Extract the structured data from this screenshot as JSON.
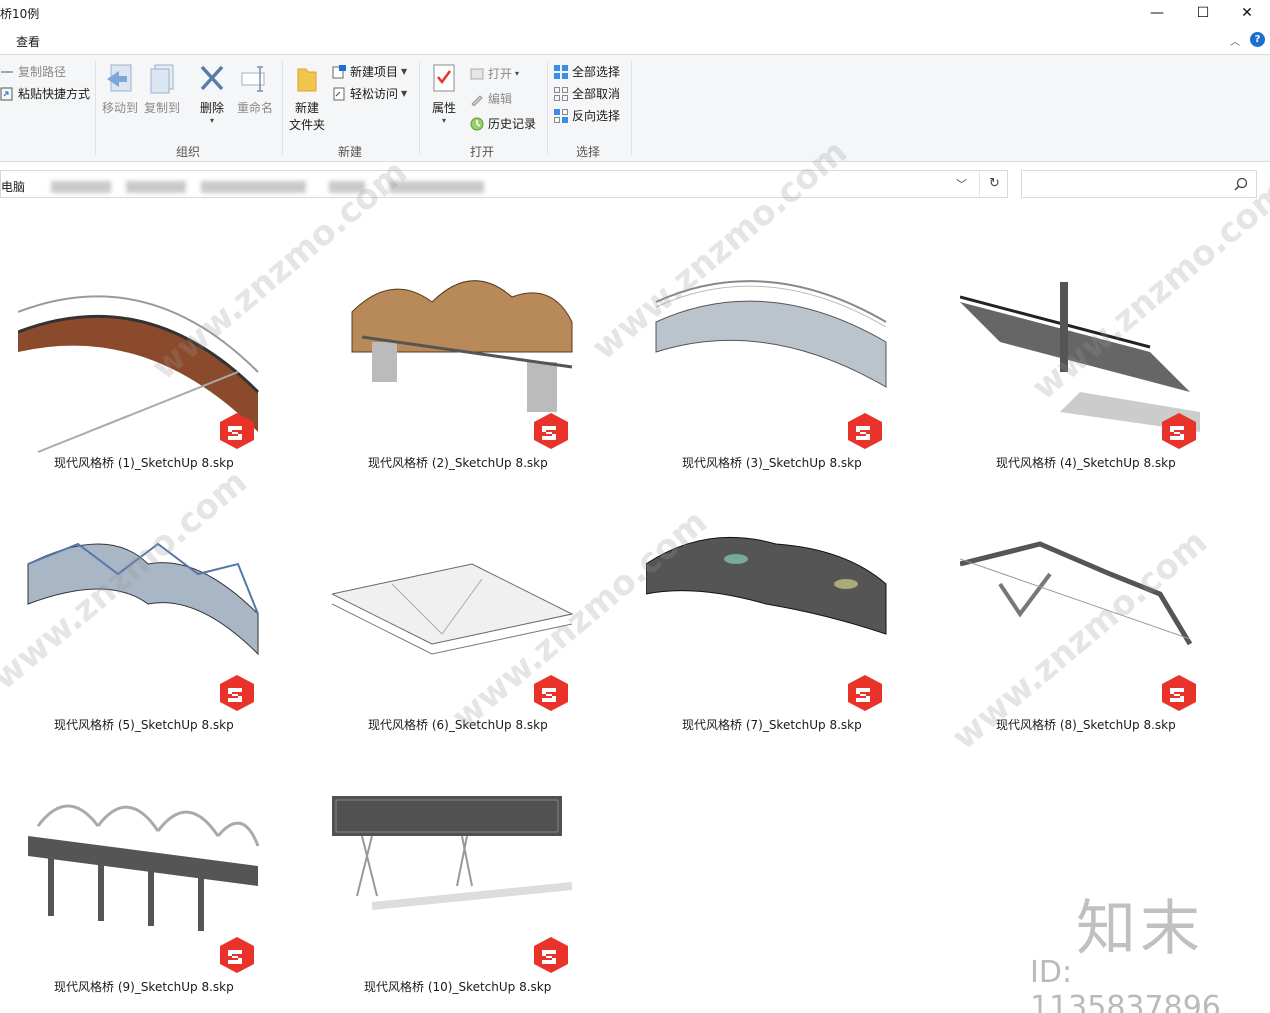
{
  "window": {
    "title": "桥10例",
    "minimize_glyph": "—",
    "maximize_glyph": "☐",
    "close_glyph": "✕"
  },
  "menu": {
    "view_tab": "查看",
    "help_glyph": "?"
  },
  "ribbon": {
    "clipboard": {
      "copy_path": "复制路径",
      "paste_shortcut": "粘贴快捷方式"
    },
    "organize": {
      "label": "组织",
      "move_to": "移动到",
      "copy_to": "复制到",
      "delete": "删除",
      "rename": "重命名"
    },
    "new": {
      "label": "新建",
      "new_folder_line1": "新建",
      "new_folder_line2": "文件夹",
      "new_item": "新建项目",
      "easy_access": "轻松访问"
    },
    "open": {
      "label": "打开",
      "properties": "属性",
      "open": "打开",
      "edit": "编辑",
      "history": "历史记录"
    },
    "select": {
      "label": "选择",
      "select_all": "全部选择",
      "select_none": "全部取消",
      "invert": "反向选择"
    }
  },
  "address": {
    "root": "电脑",
    "search_placeholder": ""
  },
  "files": [
    {
      "name": "现代风格桥 (1)_SketchUp 8.skp"
    },
    {
      "name": "现代风格桥 (2)_SketchUp 8.skp"
    },
    {
      "name": "现代风格桥 (3)_SketchUp 8.skp"
    },
    {
      "name": "现代风格桥 (4)_SketchUp 8.skp"
    },
    {
      "name": "现代风格桥 (5)_SketchUp 8.skp"
    },
    {
      "name": "现代风格桥 (6)_SketchUp 8.skp"
    },
    {
      "name": "现代风格桥 (7)_SketchUp 8.skp"
    },
    {
      "name": "现代风格桥 (8)_SketchUp 8.skp"
    },
    {
      "name": "现代风格桥 (9)_SketchUp 8.skp"
    },
    {
      "name": "现代风格桥 (10)_SketchUp 8.skp"
    }
  ],
  "watermark": {
    "brand": "知末",
    "id": "ID: 1135837896",
    "site": "www.znzmo.com"
  },
  "colors": {
    "accent": "#1c6fd1",
    "sketchup_red": "#e8322a"
  }
}
